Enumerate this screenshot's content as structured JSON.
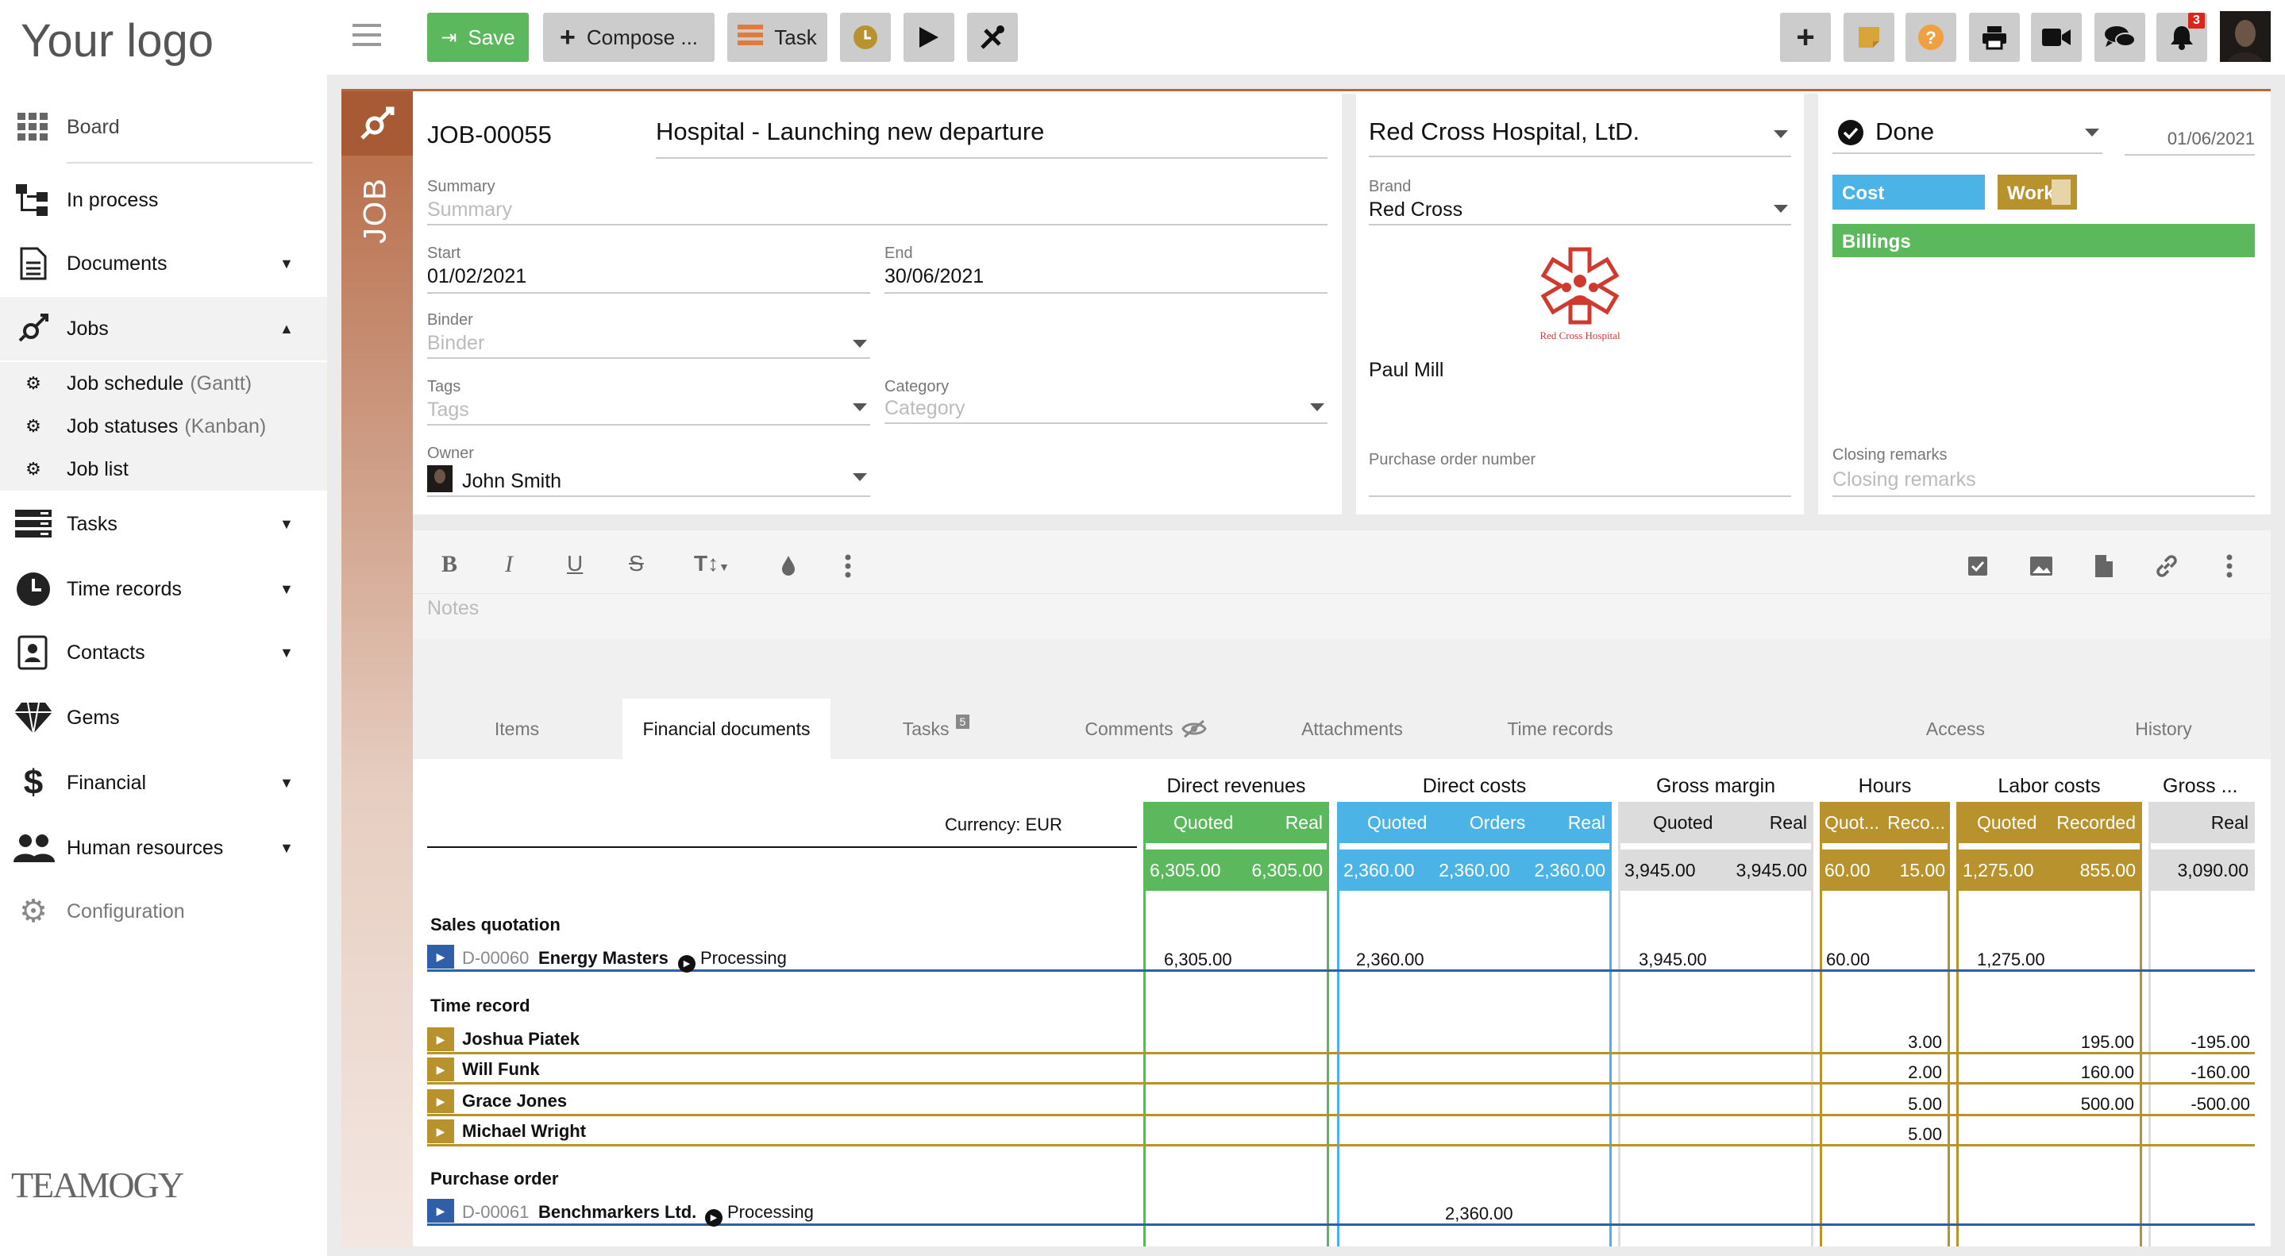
{
  "sidebar": {
    "logo": "Your logo",
    "items": [
      {
        "label": "Board"
      },
      {
        "label": "In process"
      },
      {
        "label": "Documents"
      },
      {
        "label": "Jobs"
      },
      {
        "label": "Tasks"
      },
      {
        "label": "Time records"
      },
      {
        "label": "Contacts"
      },
      {
        "label": "Gems"
      },
      {
        "label": "Financial"
      },
      {
        "label": "Human resources"
      },
      {
        "label": "Configuration"
      }
    ],
    "sub_items": [
      {
        "label": "Job schedule",
        "suffix": "(Gantt)"
      },
      {
        "label": "Job statuses",
        "suffix": "(Kanban)"
      },
      {
        "label": "Job list",
        "suffix": ""
      }
    ],
    "brand": "TEAMOGY"
  },
  "toolbar": {
    "save": "Save",
    "compose": "Compose ...",
    "task": "Task",
    "notification_count": "3"
  },
  "job": {
    "strip_label": "JOB",
    "id": "JOB-00055",
    "title": "Hospital - Launching new departure",
    "summary_label": "Summary",
    "summary_placeholder": "Summary",
    "start_label": "Start",
    "start": "01/02/2021",
    "end_label": "End",
    "end": "30/06/2021",
    "binder_label": "Binder",
    "binder_placeholder": "Binder",
    "tags_label": "Tags",
    "tags_placeholder": "Tags",
    "category_label": "Category",
    "category_placeholder": "Category",
    "owner_label": "Owner",
    "owner": "John Smith"
  },
  "client": {
    "name": "Red Cross Hospital, LtD.",
    "brand_label": "Brand",
    "brand": "Red Cross",
    "logo_caption": "Red Cross Hospital",
    "contact": "Paul Mill",
    "po_label": "Purchase order number"
  },
  "status": {
    "value": "Done",
    "date": "01/06/2021",
    "cost": "Cost",
    "work": "Work",
    "billings": "Billings",
    "closing_label": "Closing remarks",
    "closing_placeholder": "Closing remarks"
  },
  "editor": {
    "notes_placeholder": "Notes"
  },
  "tabs": [
    {
      "label": "Items"
    },
    {
      "label": "Financial documents",
      "active": true
    },
    {
      "label": "Tasks",
      "badge": "5"
    },
    {
      "label": "Comments"
    },
    {
      "label": "Attachments"
    },
    {
      "label": "Time records"
    },
    {
      "label": "Access"
    },
    {
      "label": "History"
    }
  ],
  "fin": {
    "currency": "Currency: EUR",
    "groups": {
      "direct_revenues": "Direct revenues",
      "direct_costs": "Direct costs",
      "gross_margin": "Gross margin",
      "hours": "Hours",
      "labor_costs": "Labor costs",
      "gross2": "Gross ..."
    },
    "cols": {
      "dr_q": "Quoted",
      "dr_r": "Real",
      "dc_q": "Quoted",
      "dc_o": "Orders",
      "dc_r": "Real",
      "gm_q": "Quoted",
      "gm_r": "Real",
      "h_q": "Quot...",
      "h_r": "Reco...",
      "lc_q": "Quoted",
      "lc_r": "Recorded",
      "g2_r": "Real"
    },
    "totals": {
      "dr_q": "6,305.00",
      "dr_r": "6,305.00",
      "dc_q": "2,360.00",
      "dc_o": "2,360.00",
      "dc_r": "2,360.00",
      "gm_q": "3,945.00",
      "gm_r": "3,945.00",
      "h_q": "60.00",
      "h_r": "15.00",
      "lc_q": "1,275.00",
      "lc_r": "855.00",
      "g2_r": "3,090.00"
    },
    "sales": {
      "section": "Sales quotation",
      "doc": "D-00060",
      "party": "Energy Masters",
      "state": "Processing",
      "dr_q": "6,305.00",
      "dc_q": "2,360.00",
      "gm_q": "3,945.00",
      "h_q": "60.00",
      "lc_q": "1,275.00"
    },
    "time_section": "Time record",
    "time_rows": [
      {
        "name": "Joshua Piatek",
        "h_r": "3.00",
        "lc_r": "195.00",
        "g2_r": "-195.00"
      },
      {
        "name": "Will Funk",
        "h_r": "2.00",
        "lc_r": "160.00",
        "g2_r": "-160.00"
      },
      {
        "name": "Grace Jones",
        "h_r": "5.00",
        "lc_r": "500.00",
        "g2_r": "-500.00"
      },
      {
        "name": "Michael Wright",
        "h_r": "5.00",
        "lc_r": "",
        "g2_r": ""
      }
    ],
    "po": {
      "section": "Purchase order",
      "doc": "D-00061",
      "party": "Benchmarkers Ltd.",
      "state": "Processing",
      "dc_o": "2,360.00"
    }
  },
  "colors": {
    "green": "#5cb85c",
    "blue": "#4cb3e6",
    "gold": "#b8922c",
    "grey": "#dcdcdc",
    "job_accent": "#b5673f"
  }
}
